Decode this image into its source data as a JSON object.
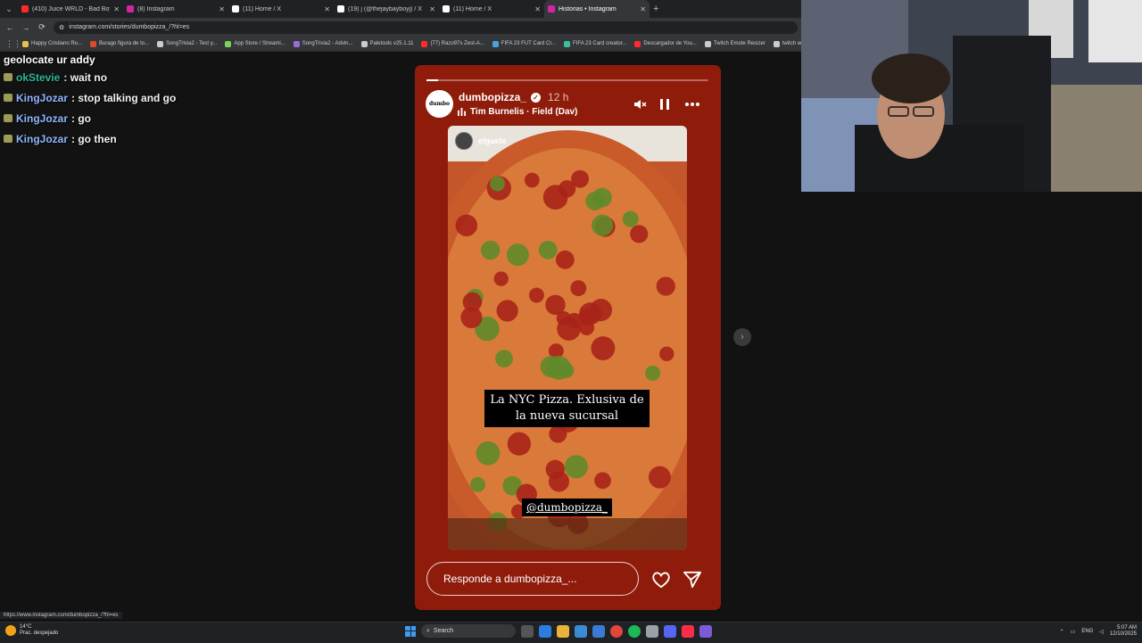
{
  "browser": {
    "tabs": [
      {
        "title": "(410) Juice WRLD - Bad Boy ft",
        "color": "#ff2a2a"
      },
      {
        "title": "(8) Instagram",
        "color": "#d6249f"
      },
      {
        "title": "(11) Home / X",
        "color": "#ffffff"
      },
      {
        "title": "(19) j (@thejaybayboyj) / X",
        "color": "#ffffff"
      },
      {
        "title": "(11) Home / X",
        "color": "#ffffff"
      },
      {
        "title": "Historias • Instagram",
        "color": "#d6249f"
      }
    ],
    "new_tab": "+",
    "address": "instagram.com/stories/dumbopizza_/?hl=es",
    "bookmarks": [
      {
        "label": "Happy Cristiano Ro...",
        "color": "#e6c24a"
      },
      {
        "label": "Burago figura de to...",
        "color": "#e04a2a"
      },
      {
        "label": "SongTrivia2 - Test y...",
        "color": "#cccccc"
      },
      {
        "label": "App Store / Streami...",
        "color": "#7bd35a"
      },
      {
        "label": "SongTrivia2 - Advin...",
        "color": "#9a6cd6"
      },
      {
        "label": "Paletools v25.1.11",
        "color": "#cccccc"
      },
      {
        "label": "(77) Razo97s Zest-A...",
        "color": "#ff2a2a"
      },
      {
        "label": "FIFA 23 FUT Card Cr...",
        "color": "#4aa3e0"
      },
      {
        "label": "FIFA 23 Card creator...",
        "color": "#3ac0a0"
      },
      {
        "label": "Descargador de You...",
        "color": "#ff2a2a"
      },
      {
        "label": "Twitch Emote Resizer",
        "color": "#cccccc"
      },
      {
        "label": "twitch em",
        "color": "#cccccc"
      }
    ]
  },
  "chat": {
    "header": "geolocate ur addy",
    "messages": [
      {
        "user": "okStevie",
        "text": ": wait no",
        "teal": true
      },
      {
        "user": "KingJozar",
        "text": ": stop talking and go",
        "teal": false
      },
      {
        "user": "KingJozar",
        "text": ": go",
        "teal": false
      },
      {
        "user": "KingJozar",
        "text": ": go then",
        "teal": false
      }
    ]
  },
  "story": {
    "progress_fraction": 0.04,
    "avatar_text": "dumbo",
    "username": "dumbopizza_",
    "verified_mark": "✓",
    "time_ago": "12 h",
    "music": "Tim Burnelis · Field (Dav)",
    "photo_username": "elguefe",
    "caption": "La NYC Pizza. Exlusiva de la nueva sucursal",
    "mention": "@dumbopizza_",
    "reply_placeholder": "Responde a dumbopizza_...",
    "next_arrow": "›"
  },
  "status_url": "https://www.instagram.com/dumbopizza_/?hl=es",
  "taskbar": {
    "weather_temp": "14°C",
    "weather_desc": "Prac. despejado",
    "search_label": "Search",
    "language": "ENG",
    "time": "5:07 AM",
    "date": "12/10/2025"
  }
}
